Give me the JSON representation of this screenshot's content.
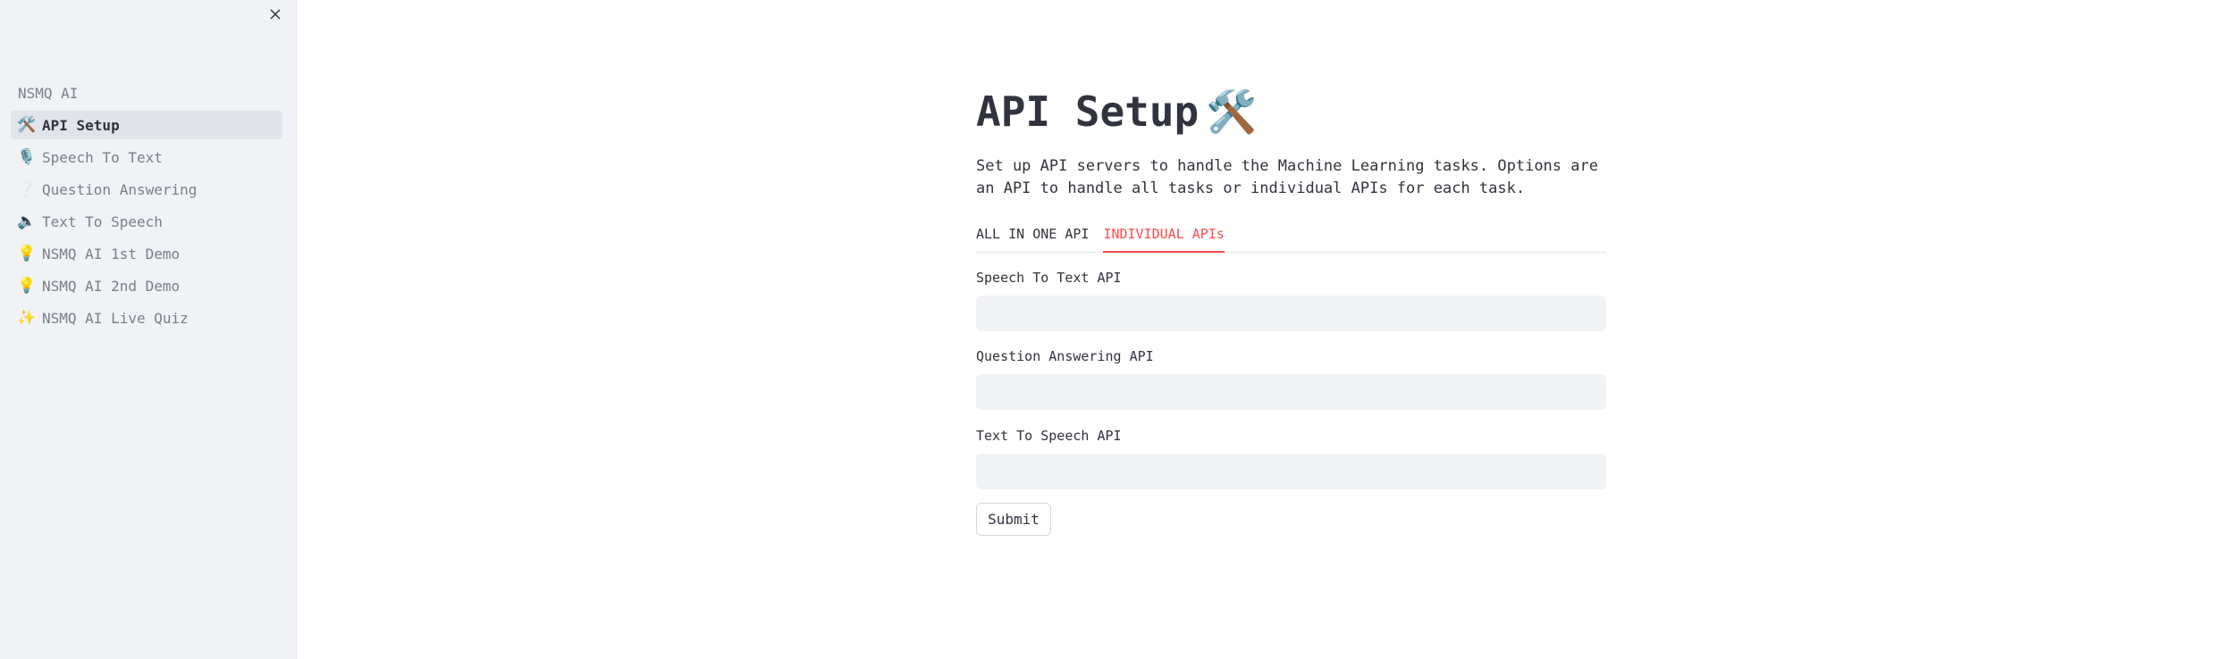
{
  "sidebar": {
    "close_icon": "close-icon",
    "app_name": "NSMQ AI",
    "items": [
      {
        "icon": "🛠️",
        "icon_name": "hammer-wrench-icon",
        "label": "API Setup",
        "active": true
      },
      {
        "icon": "🎙️",
        "icon_name": "microphone-icon",
        "label": "Speech To Text",
        "active": false
      },
      {
        "icon": "❔",
        "icon_name": "question-icon",
        "label": "Question Answering",
        "active": false
      },
      {
        "icon": "🔈",
        "icon_name": "speaker-icon",
        "label": "Text To Speech",
        "active": false
      },
      {
        "icon": "💡",
        "icon_name": "lightbulb-icon",
        "label": "NSMQ AI 1st Demo",
        "active": false
      },
      {
        "icon": "💡",
        "icon_name": "lightbulb-icon",
        "label": "NSMQ AI 2nd Demo",
        "active": false
      },
      {
        "icon": "✨",
        "icon_name": "sparkles-icon",
        "label": "NSMQ AI Live Quiz",
        "active": false
      }
    ]
  },
  "main": {
    "title": "API Setup",
    "title_icon": "🛠️",
    "description": "Set up API servers to handle the Machine Learning tasks. Options are an API to handle all tasks or individual APIs for each task.",
    "tabs": [
      {
        "label": "ALL IN ONE API",
        "active": false
      },
      {
        "label": "INDIVIDUAL APIs",
        "active": true
      }
    ],
    "fields": [
      {
        "label": "Speech To Text API",
        "value": "",
        "placeholder": ""
      },
      {
        "label": "Question Answering API",
        "value": "",
        "placeholder": ""
      },
      {
        "label": "Text To Speech API",
        "value": "",
        "placeholder": ""
      }
    ],
    "submit_label": "Submit"
  },
  "colors": {
    "sidebar_bg": "#f0f2f6",
    "active_item_bg": "#e1e4eb",
    "accent": "#ff4b4b",
    "text": "#31333f",
    "input_bg": "#f0f2f6"
  }
}
